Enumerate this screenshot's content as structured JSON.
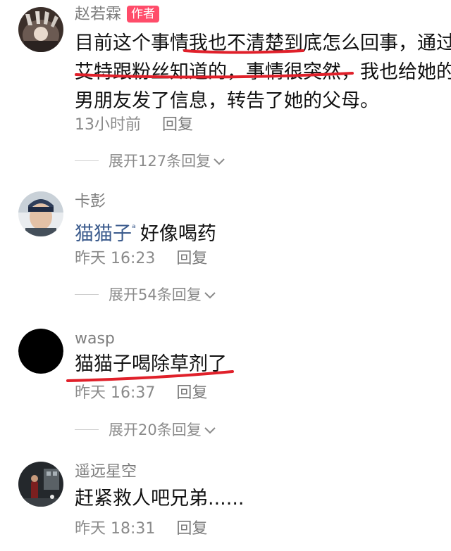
{
  "comments": [
    {
      "username": "赵若霖",
      "badge": "作者",
      "lines": [
        "目前这个事情我也不清楚到底怎么回事，通过",
        "艾特跟粉丝知道的，事情很突然，我也给她的",
        "男朋友发了信息，转告了她的父母。"
      ],
      "time": "13小时前",
      "reply": "回复",
      "expand": "展开127条回复"
    },
    {
      "username": "卡彭",
      "mention": "猫猫子",
      "text": "好像喝药",
      "time": "昨天 16:23",
      "reply": "回复",
      "expand": "展开54条回复"
    },
    {
      "username": "wasp",
      "text": "猫猫子喝除草剂了",
      "time": "昨天 16:37",
      "reply": "回复",
      "expand": "展开20条回复"
    },
    {
      "username": "遥远星空",
      "text": "赶紧救人吧兄弟......",
      "time": "昨天 18:31",
      "reply": "回复"
    }
  ],
  "colors": {
    "annotation_red": "#e0202a",
    "badge": "#ff4c6a",
    "meta_gray": "#8a8a8a",
    "mention_blue": "#3a5a8c"
  },
  "icons": {
    "mention": "person-icon",
    "expand_chevron": "chevron-down-icon"
  }
}
